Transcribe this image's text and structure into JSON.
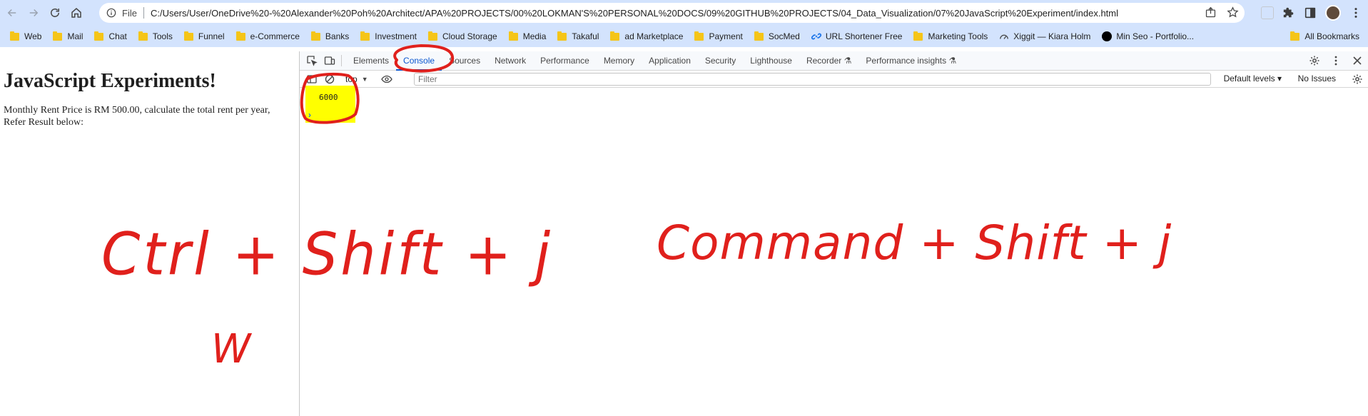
{
  "browser": {
    "address": {
      "scheme_label": "File",
      "url": "C:/Users/User/OneDrive%20-%20Alexander%20Poh%20Architect/APA%20PROJECTS/00%20LOKMAN'S%20PERSONAL%20DOCS/09%20GITHUB%20PROJECTS/04_Data_Visualization/07%20JavaScript%20Experiment/index.html"
    },
    "bookmarks": [
      {
        "label": "Web",
        "icon": "folder-icon"
      },
      {
        "label": "Mail",
        "icon": "folder-icon"
      },
      {
        "label": "Chat",
        "icon": "folder-icon"
      },
      {
        "label": "Tools",
        "icon": "folder-icon"
      },
      {
        "label": "Funnel",
        "icon": "folder-icon"
      },
      {
        "label": "e-Commerce",
        "icon": "folder-icon"
      },
      {
        "label": "Banks",
        "icon": "folder-icon"
      },
      {
        "label": "Investment",
        "icon": "folder-icon"
      },
      {
        "label": "Cloud Storage",
        "icon": "folder-icon"
      },
      {
        "label": "Media",
        "icon": "folder-icon"
      },
      {
        "label": "Takaful",
        "icon": "folder-icon"
      },
      {
        "label": "ad Marketplace",
        "icon": "folder-icon"
      },
      {
        "label": "Payment",
        "icon": "folder-icon"
      },
      {
        "label": "SocMed",
        "icon": "folder-icon"
      },
      {
        "label": "URL Shortener Free",
        "icon": "link-icon"
      },
      {
        "label": "Marketing Tools",
        "icon": "folder-icon"
      },
      {
        "label": "Xiggit — Kiara Holm",
        "icon": "gauge-icon"
      },
      {
        "label": "Min Seo - Portfolio...",
        "icon": "black-circle-icon"
      }
    ],
    "bookmarks_more": "»",
    "all_bookmarks": "All Bookmarks"
  },
  "page": {
    "heading": "JavaScript Experiments!",
    "paragraph": "Monthly Rent Price is RM 500.00, calculate the total rent per year, Refer Result below:"
  },
  "devtools": {
    "tabs": [
      {
        "label": "Elements",
        "active": false
      },
      {
        "label": "Console",
        "active": true
      },
      {
        "label": "Sources",
        "active": false
      },
      {
        "label": "Network",
        "active": false
      },
      {
        "label": "Performance",
        "active": false
      },
      {
        "label": "Memory",
        "active": false
      },
      {
        "label": "Application",
        "active": false
      },
      {
        "label": "Security",
        "active": false
      },
      {
        "label": "Lighthouse",
        "active": false
      },
      {
        "label": "Recorder ⚗",
        "active": false
      },
      {
        "label": "Performance insights ⚗",
        "active": false
      }
    ],
    "context_select": "top",
    "filter_placeholder": "Filter",
    "levels_label": "Default levels ▾",
    "issues_label": "No Issues",
    "console_output": "6000",
    "prompt": "›"
  },
  "annotations": {
    "left_text": "Ctrl + Shift + j",
    "left_sub": "W",
    "right_text": "Command + Shift + j",
    "ink_color": "#e0201c",
    "highlight_color": "#ffff00"
  }
}
